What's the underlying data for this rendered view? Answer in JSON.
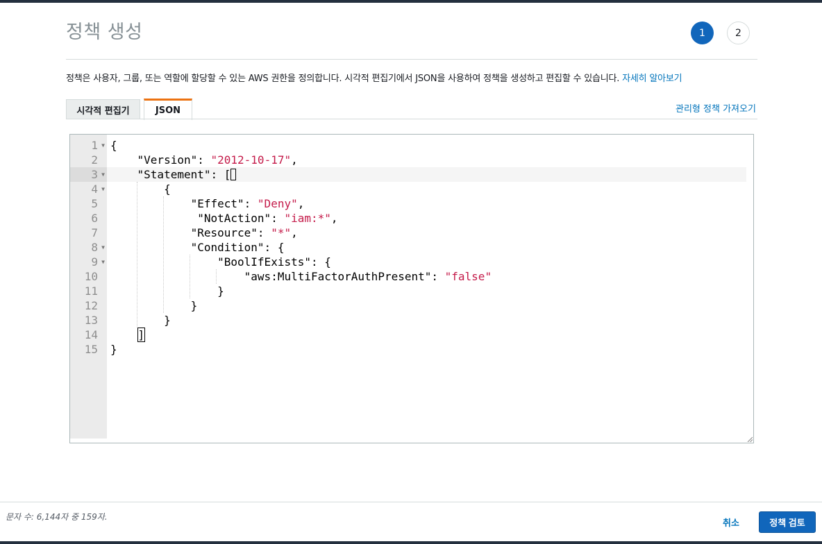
{
  "page": {
    "title": "정책 생성",
    "steps": [
      "1",
      "2"
    ],
    "description": "정책은 사용자, 그룹, 또는 역할에 할당할 수 있는 AWS 권한을 정의합니다. 시각적 편집기에서 JSON을 사용하여 정책을 생성하고 편집할 수 있습니다. ",
    "learn_more": "자세히 알아보기"
  },
  "tabs": {
    "visual": "시각적 편집기",
    "json": "JSON",
    "active": "JSON"
  },
  "import_link": "관리형 정책 가져오기",
  "editor": {
    "line_numbers": [
      "1",
      "2",
      "3",
      "4",
      "5",
      "6",
      "7",
      "8",
      "9",
      "10",
      "11",
      "12",
      "13",
      "14",
      "15"
    ],
    "lines": [
      "{",
      "    \"Version\": \"2012-10-17\",",
      "    \"Statement\": [",
      "        {",
      "            \"Effect\": \"Deny\",",
      "             \"NotAction\": \"iam:*\",",
      "            \"Resource\": \"*\",",
      "            \"Condition\": {",
      "                \"BoolIfExists\": {",
      "                    \"aws:MultiFactorAuthPresent\": \"false\"",
      "                }",
      "            }",
      "        }",
      "    ]",
      "}"
    ],
    "active_line": 3
  },
  "footer": {
    "char_count": "문자 수: 6,144자 중 159자.",
    "cancel": "취소",
    "review": "정책 검토"
  },
  "colors": {
    "primary": "#1166bb",
    "link": "#0073bb",
    "tab_accent": "#ec7211",
    "string": "#c41a49",
    "topbar": "#232f3e"
  }
}
